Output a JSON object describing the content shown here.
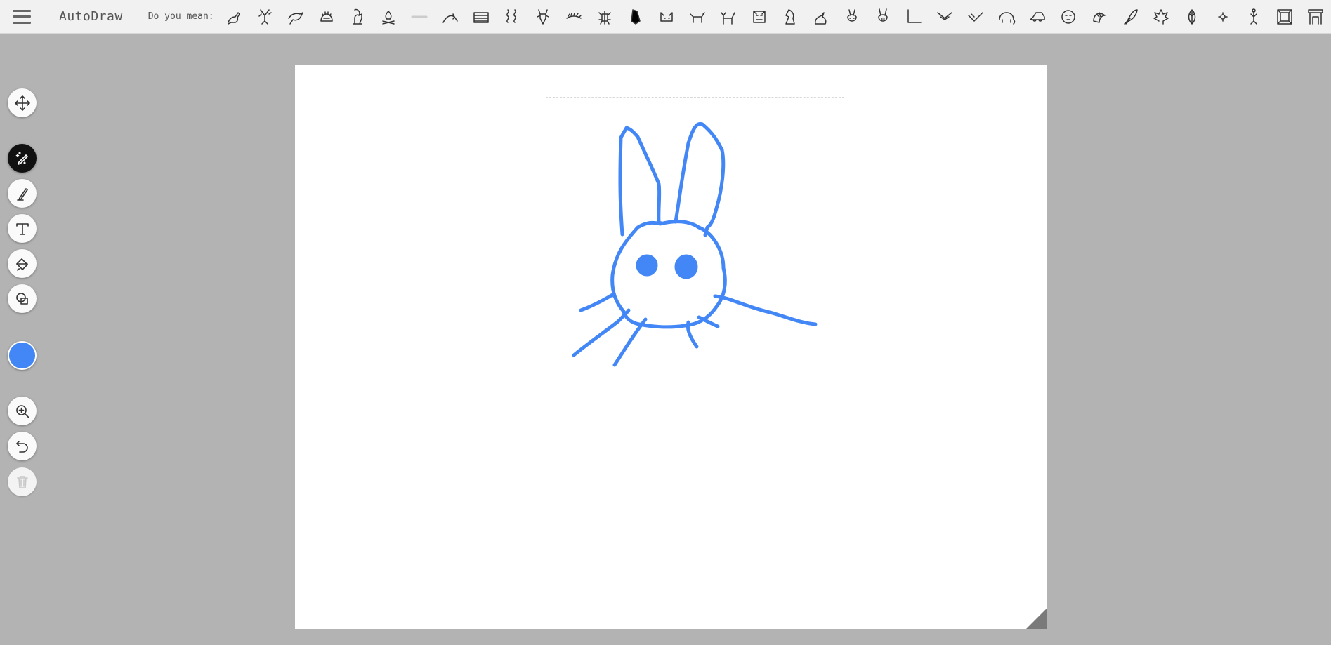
{
  "app": {
    "title": "AutoDraw"
  },
  "suggestions": {
    "label": "Do you mean:",
    "items": [
      {
        "icon": "kangaroo-icon"
      },
      {
        "icon": "dancer-icon"
      },
      {
        "icon": "bird-icon"
      },
      {
        "icon": "hedgehog-icon"
      },
      {
        "icon": "squirrel-icon"
      },
      {
        "icon": "campfire-icon"
      },
      {
        "icon": "line-icon"
      },
      {
        "icon": "curved-arrow-icon"
      },
      {
        "icon": "wall-icon"
      },
      {
        "icon": "wiggle-lines-icon"
      },
      {
        "icon": "lobster-icon"
      },
      {
        "icon": "leaf-branch-icon"
      },
      {
        "icon": "bug-icon"
      },
      {
        "icon": "penguin-icon"
      },
      {
        "icon": "cat-face-icon"
      },
      {
        "icon": "dog-icon"
      },
      {
        "icon": "cat-icon"
      },
      {
        "icon": "monkey-face-icon"
      },
      {
        "icon": "chess-knight-icon"
      },
      {
        "icon": "rabbit-sitting-icon"
      },
      {
        "icon": "bunny-face-icon"
      },
      {
        "icon": "bunny-head-icon"
      },
      {
        "icon": "corner-icon"
      },
      {
        "icon": "chevron-down-icon"
      },
      {
        "icon": "check-icon"
      },
      {
        "icon": "elephant-icon"
      },
      {
        "icon": "car-icon"
      },
      {
        "icon": "lion-icon"
      },
      {
        "icon": "shell-icon"
      },
      {
        "icon": "feather-icon"
      },
      {
        "icon": "maple-leaf-icon"
      },
      {
        "icon": "leaf-icon"
      },
      {
        "icon": "spark-icon"
      },
      {
        "icon": "figure-icon"
      },
      {
        "icon": "frame-icon"
      },
      {
        "icon": "fireplace-icon"
      }
    ]
  },
  "toolbar": {
    "tools": [
      {
        "name": "move-tool",
        "icon": "move-icon"
      },
      {
        "name": "autodraw-tool",
        "icon": "magic-pen-icon",
        "active": true
      },
      {
        "name": "draw-tool",
        "icon": "pencil-icon"
      },
      {
        "name": "type-tool",
        "icon": "text-icon"
      },
      {
        "name": "fill-tool",
        "icon": "paint-bucket-icon"
      },
      {
        "name": "shape-tool",
        "icon": "shapes-icon"
      },
      {
        "name": "zoom-tool",
        "icon": "zoom-in-icon"
      },
      {
        "name": "undo-tool",
        "icon": "undo-icon"
      },
      {
        "name": "delete-tool",
        "icon": "trash-icon",
        "disabled": true
      }
    ],
    "color": "#4287f5"
  },
  "colors": {
    "stroke": "#4287f5",
    "background": "#b3b3b3",
    "canvas": "#ffffff"
  }
}
